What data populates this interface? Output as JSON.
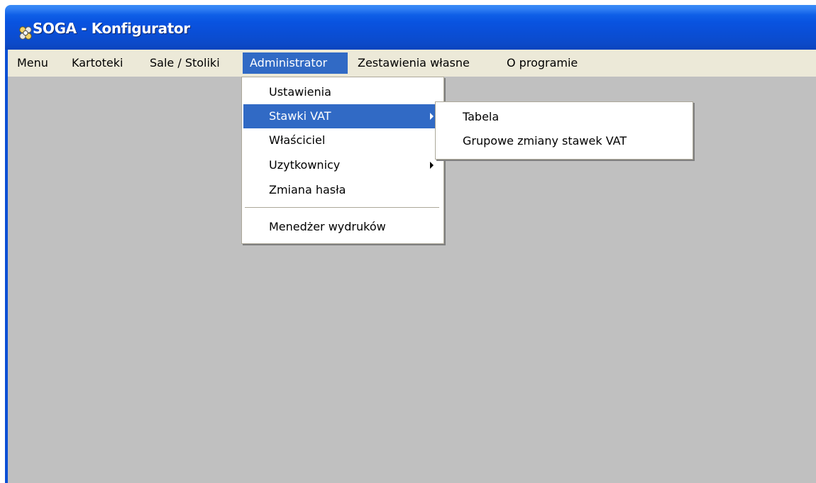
{
  "window": {
    "title": "SOGA - Konfigurator",
    "icon": "soga-app-icon"
  },
  "menubar": {
    "items": [
      {
        "label": "Menu"
      },
      {
        "label": "Kartoteki"
      },
      {
        "label": "Sale / Stoliki"
      },
      {
        "label": "Administrator",
        "active": true
      },
      {
        "label": "Zestawienia własne"
      },
      {
        "label": "O programie"
      }
    ]
  },
  "admin_menu": {
    "items": [
      {
        "label": "Ustawienia"
      },
      {
        "label": "Stawki VAT",
        "submenu": true,
        "highlighted": true
      },
      {
        "label": "Właściciel"
      },
      {
        "label": "Uzytkownicy",
        "submenu": true
      },
      {
        "label": "Zmiana hasła"
      },
      {
        "label": "Menedżer wydruków"
      }
    ]
  },
  "vat_submenu": {
    "items": [
      {
        "label": "Tabela"
      },
      {
        "label": "Grupowe zmiany stawek VAT"
      }
    ]
  },
  "colors": {
    "titlebar": "#0953e0",
    "menu_highlight": "#316ac5",
    "menubar_bg": "#ece9d8",
    "client_bg": "#c0c0c0"
  }
}
